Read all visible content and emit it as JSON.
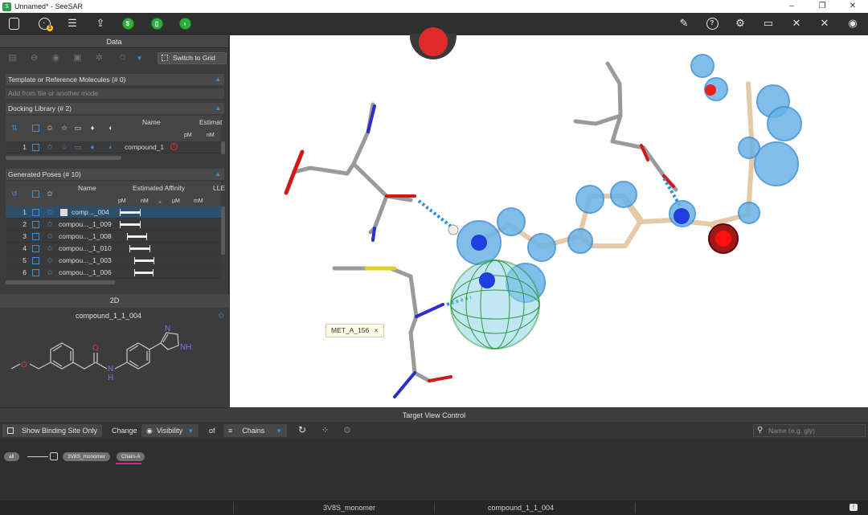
{
  "window": {
    "title": "Unnamed* - SeeSAR",
    "app_icon": "seesar-icon"
  },
  "toolbar": {
    "molecules_badge": "1"
  },
  "data_panel": {
    "title": "Data",
    "switch_to_grid_label": "Switch to Grid"
  },
  "template_section": {
    "title": "Template or Reference Molecules",
    "count": "(# 0)",
    "placeholder": "Add from file or another mode"
  },
  "docking_library": {
    "title": "Docking Library",
    "count": "(# 2)",
    "col_name": "Name",
    "col_estimated": "Estimat",
    "unit_pm": "pM",
    "unit_nm": "nM",
    "rows": [
      {
        "num": "1",
        "name": "compound_1"
      }
    ]
  },
  "generated_poses": {
    "title": "Generated Poses",
    "count": "(# 10)",
    "col_name": "Name",
    "col_affinity": "Estimated Affinity",
    "col_lle": "LLE",
    "units": [
      "pM",
      "nM",
      "μM",
      "mM"
    ],
    "rows": [
      {
        "num": "1",
        "name": "comp..._004",
        "selected": true
      },
      {
        "num": "2",
        "name": "compou..._1_009"
      },
      {
        "num": "3",
        "name": "compou..._1_008"
      },
      {
        "num": "4",
        "name": "compou..._1_010"
      },
      {
        "num": "5",
        "name": "compou..._1_003"
      },
      {
        "num": "6",
        "name": "compou..._1_006"
      }
    ]
  },
  "two_d_panel": {
    "title": "2D",
    "compound_name": "compound_1_1_004",
    "atom_labels": {
      "o": "O",
      "nh_pyrazole": "NH",
      "n_pyrazole": "N",
      "o_carbonyl": "O",
      "n_amide": "N",
      "h_amide": "H"
    }
  },
  "viewport": {
    "residue_tag": "MET_A_156",
    "residue_tag_close": "×"
  },
  "target_view_control": {
    "title": "Target View Control",
    "show_binding_site_label": "Show Binding Site Only",
    "change_label": "Change",
    "visibility_label": "Visibility",
    "of_label": "of",
    "chains_label": "Chains",
    "search_placeholder": "Name (e.g. gly)",
    "tree": {
      "all": "all",
      "monomer": "3V8S_monomer",
      "chain": "Chain-A"
    }
  },
  "statusbar": {
    "target": "3V8S_monomer",
    "compound": "compound_1_1_004"
  },
  "colors": {
    "accent_blue": "#3f8fd8",
    "seesar_red": "#e02b2b",
    "chain_underline": "#e0247a"
  }
}
